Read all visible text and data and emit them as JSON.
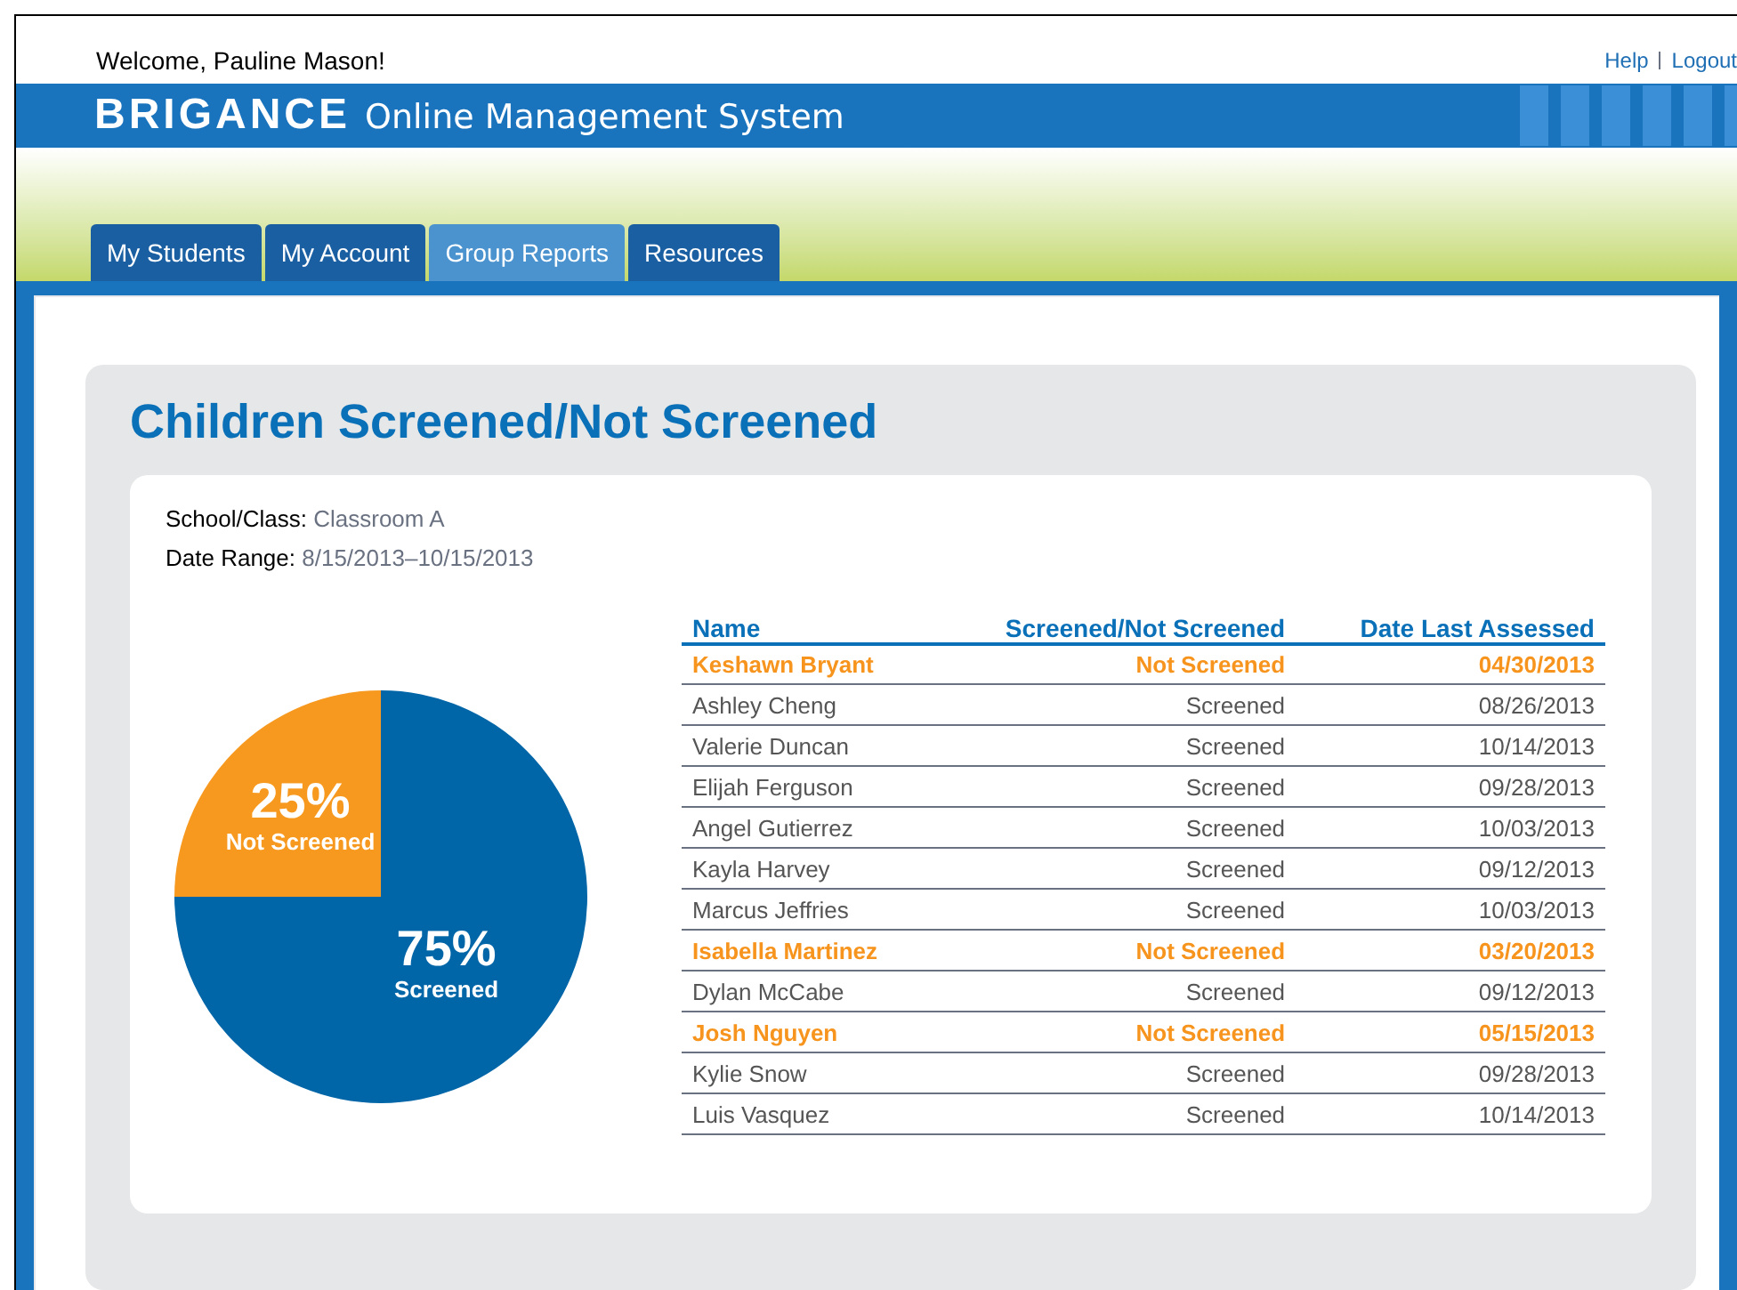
{
  "header": {
    "welcome": "Welcome, Pauline Mason!",
    "links": [
      "Help",
      "Logout"
    ],
    "brand": "BRIGANCE",
    "subtitle": "Online Management System"
  },
  "tabs": [
    {
      "label": "My Students",
      "selected": false
    },
    {
      "label": "My Account",
      "selected": false
    },
    {
      "label": "Group Reports",
      "selected": true
    },
    {
      "label": "Resources",
      "selected": false
    }
  ],
  "report": {
    "title": "Children Screened/Not Screened",
    "filters": [
      {
        "label": "School/Class:",
        "value": "Classroom A"
      },
      {
        "label": "Date Range:",
        "value": "8/15/2013–10/15/2013"
      }
    ],
    "chart_data": {
      "type": "pie",
      "categories": [
        "Not Screened",
        "Screened"
      ],
      "values": [
        25,
        75
      ],
      "value_labels": [
        "25%",
        "75%"
      ]
    },
    "table": {
      "columns": [
        "Name",
        "Screened/Not Screened",
        "Date Last Assessed"
      ],
      "rows": [
        {
          "kind": "not_screened",
          "cells": [
            "Keshawn Bryant",
            "Not Screened",
            "04/30/2013"
          ]
        },
        {
          "kind": "screened",
          "cells": [
            "Ashley Cheng",
            "Screened",
            "08/26/2013"
          ]
        },
        {
          "kind": "screened",
          "cells": [
            "Valerie Duncan",
            "Screened",
            "10/14/2013"
          ]
        },
        {
          "kind": "screened",
          "cells": [
            "Elijah Ferguson",
            "Screened",
            "09/28/2013"
          ]
        },
        {
          "kind": "screened",
          "cells": [
            "Angel Gutierrez",
            "Screened",
            "10/03/2013"
          ]
        },
        {
          "kind": "screened",
          "cells": [
            "Kayla Harvey",
            "Screened",
            "09/12/2013"
          ]
        },
        {
          "kind": "screened",
          "cells": [
            "Marcus Jeffries",
            "Screened",
            "10/03/2013"
          ]
        },
        {
          "kind": "not_screened",
          "cells": [
            "Isabella Martinez",
            "Not Screened",
            "03/20/2013"
          ]
        },
        {
          "kind": "screened",
          "cells": [
            "Dylan McCabe",
            "Screened",
            "09/12/2013"
          ]
        },
        {
          "kind": "not_screened",
          "cells": [
            "Josh Nguyen",
            "Not Screened",
            "05/15/2013"
          ]
        },
        {
          "kind": "screened",
          "cells": [
            "Kylie Snow",
            "Screened",
            "09/28/2013"
          ]
        },
        {
          "kind": "screened",
          "cells": [
            "Luis Vasquez",
            "Screened",
            "10/14/2013"
          ]
        }
      ]
    }
  }
}
